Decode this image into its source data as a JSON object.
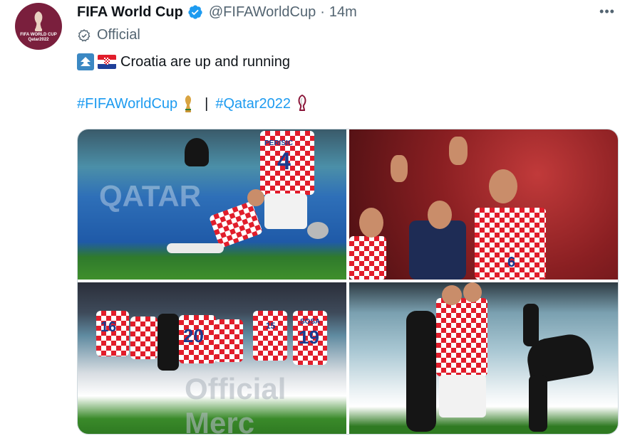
{
  "tweet": {
    "avatar_alt_text": "FIFA WORLD CUP Qatar2022",
    "display_name": "FIFA World Cup",
    "handle": "@FIFAWorldCup",
    "separator": "·",
    "timestamp": "14m",
    "label": "Official",
    "text": "Croatia are up and running",
    "hashtags": [
      "#FIFAWorldCup",
      "#Qatar2022"
    ],
    "hashtag_separator": "|",
    "more_label": "•••"
  },
  "media": {
    "photo_count": 4,
    "photos": [
      {
        "name": "Perisic celebration photo",
        "jersey_name": "PERISIC",
        "jersey_number": "4"
      },
      {
        "name": "Lovren waving photo",
        "jersey_number": "6"
      },
      {
        "name": "Croatia team celebrating photo",
        "jersey_numbers": [
          "16",
          "20",
          "15",
          "19"
        ],
        "jersey_name": "SOSA"
      },
      {
        "name": "Croatia players embrace photo"
      }
    ]
  },
  "colors": {
    "link": "#1d9bf0",
    "secondary_text": "#536471",
    "verified": "#1d9bf0",
    "avatar_bg": "#7a1f3d"
  }
}
